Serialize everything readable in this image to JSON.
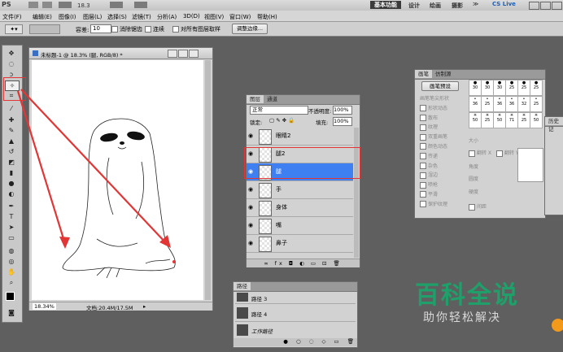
{
  "app": {
    "logo": "PS",
    "zoom": "18.3",
    "workspace_active": "基本功能",
    "workspaces": [
      "设计",
      "绘画",
      "摄影"
    ],
    "more": "≫",
    "cslive": "CS Live"
  },
  "menu": [
    "文件(F)",
    "编辑(E)",
    "图像(I)",
    "图层(L)",
    "选择(S)",
    "滤镜(T)",
    "分析(A)",
    "3D(D)",
    "视图(V)",
    "窗口(W)",
    "帮助(H)"
  ],
  "options": {
    "tolerance_label": "容差:",
    "tolerance_value": "10",
    "antialias": "消除锯齿",
    "contiguous": "连续",
    "sample_all": "对所有图层取样",
    "refine_edge": "调整边缘..."
  },
  "document": {
    "title": "未标题-1 @ 18.3% (腿, RGB/8) *",
    "zoom": "18.34%",
    "doc_info": "文档:20.4M/17.5M"
  },
  "layers_panel": {
    "tabs": [
      "图层",
      "通道"
    ],
    "blend_mode": "正常",
    "opacity_label": "不透明度:",
    "opacity_value": "100%",
    "lock_label": "锁定:",
    "fill_label": "填充:",
    "fill_value": "100%",
    "layers": [
      {
        "name": "眼睛2",
        "selected": false
      },
      {
        "name": "腿2",
        "selected": false
      },
      {
        "name": "腿",
        "selected": true
      },
      {
        "name": "手",
        "selected": false
      },
      {
        "name": "身体",
        "selected": false
      },
      {
        "name": "嘴",
        "selected": false
      },
      {
        "name": "鼻子",
        "selected": false
      }
    ]
  },
  "paths_panel": {
    "tab": "路径",
    "items": [
      "路径 3",
      "路径 4",
      "工作路径"
    ]
  },
  "brush_panel": {
    "tabs": [
      "画笔",
      "仿制源"
    ],
    "preset_button": "画笔预设",
    "options": [
      "画笔笔尖形状",
      "形状动态",
      "散布",
      "纹理",
      "双重画笔",
      "颜色动态",
      "传递",
      "杂色",
      "湿边",
      "喷枪",
      "平滑",
      "保护纹理"
    ],
    "brush_sizes": [
      "30",
      "30",
      "30",
      "25",
      "25",
      "25",
      "36",
      "25",
      "36",
      "36",
      "32",
      "25",
      "50",
      "25",
      "50",
      "71",
      "25",
      "50"
    ],
    "size_label": "大小",
    "flip_x": "翻转 X",
    "flip_y": "翻转 Y",
    "angle_label": "角度",
    "roundness_label": "圆度",
    "hardness_label": "硬度",
    "spacing_label": "间距"
  },
  "history_tab": "历史记",
  "watermark": {
    "title": "百科全说",
    "subtitle": "助你轻松解决"
  },
  "colors": {
    "red_annotation": "#e23535",
    "selection_blue": "#3e7ff1",
    "watermark_green": "#1fa06a"
  }
}
